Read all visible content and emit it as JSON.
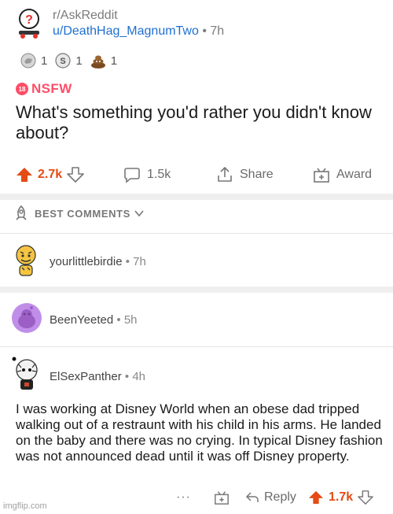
{
  "post": {
    "subreddit": "r/AskReddit",
    "author": "u/DeathHag_MagnumTwo",
    "separator": "•",
    "time": "7h",
    "awards": [
      {
        "icon": "silver-award-icon",
        "count": "1"
      },
      {
        "icon": "coin-award-icon",
        "count": "1"
      },
      {
        "icon": "poop-award-icon",
        "count": "1"
      }
    ],
    "nsfw_badge": "18",
    "nsfw_label": "NSFW",
    "title": "What's something you'd rather you didn't know about?",
    "upvotes": "2.7k",
    "comments_count": "1.5k",
    "share_label": "Share",
    "award_label": "Award"
  },
  "sort": {
    "label": "BEST COMMENTS"
  },
  "comments": [
    {
      "user": "yourlittlebirdie",
      "separator": "•",
      "time": "7h"
    },
    {
      "user": "BeenYeeted",
      "separator": "•",
      "time": "5h"
    },
    {
      "user": "ElSexPanther",
      "separator": "•",
      "time": "4h",
      "body": "I was working at Disney World when an obese dad tripped walking out of a restraunt with his child in his arms. He landed on the baby and there was no crying. In typical Disney fashion was not announced dead until it was off Disney property.",
      "more": "···",
      "reply_label": "Reply",
      "votes": "1.7k"
    }
  ],
  "watermark": "imgflip.com",
  "colors": {
    "upvote": "#e54b14",
    "link": "#1f6fd1",
    "nsfw": "#ff4d67",
    "avatar_purple": "#c08ee8"
  }
}
